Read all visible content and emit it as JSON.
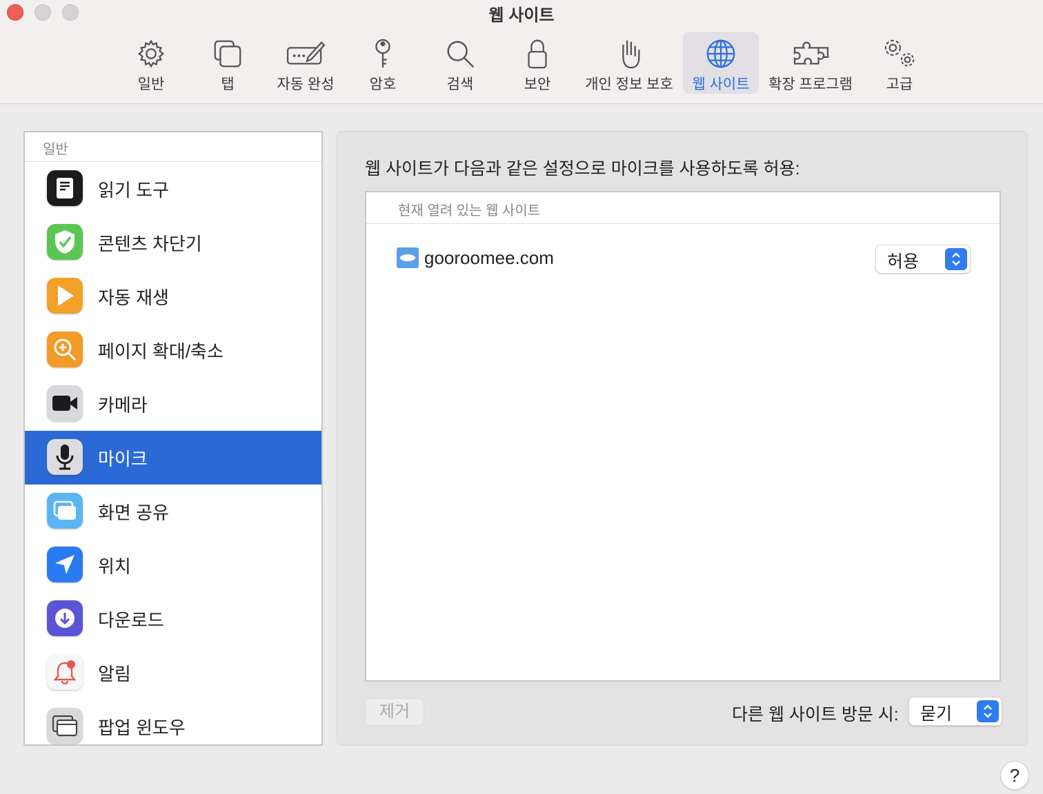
{
  "window": {
    "title": "웹 사이트"
  },
  "toolbar": [
    {
      "label": "일반",
      "icon": "gear-icon"
    },
    {
      "label": "탭",
      "icon": "tabs-icon"
    },
    {
      "label": "자동 완성",
      "icon": "autofill-pencil-icon"
    },
    {
      "label": "암호",
      "icon": "key-icon"
    },
    {
      "label": "검색",
      "icon": "magnifier-icon"
    },
    {
      "label": "보안",
      "icon": "lock-icon"
    },
    {
      "label": "개인 정보 보호",
      "icon": "hand-icon"
    },
    {
      "label": "웹 사이트",
      "icon": "globe-icon",
      "active": true
    },
    {
      "label": "확장 프로그램",
      "icon": "puzzle-icon"
    },
    {
      "label": "고급",
      "icon": "gears-icon"
    }
  ],
  "sidebar": {
    "header": "일반",
    "items": [
      {
        "label": "읽기 도구",
        "icon": "reader-icon"
      },
      {
        "label": "콘텐츠 차단기",
        "icon": "shield-check-icon"
      },
      {
        "label": "자동 재생",
        "icon": "play-icon"
      },
      {
        "label": "페이지 확대/축소",
        "icon": "zoom-icon"
      },
      {
        "label": "카메라",
        "icon": "camera-icon"
      },
      {
        "label": "마이크",
        "icon": "microphone-icon",
        "selected": true
      },
      {
        "label": "화면 공유",
        "icon": "screen-share-icon"
      },
      {
        "label": "위치",
        "icon": "location-arrow-icon"
      },
      {
        "label": "다운로드",
        "icon": "download-icon"
      },
      {
        "label": "알림",
        "icon": "bell-icon"
      },
      {
        "label": "팝업 윈도우",
        "icon": "popup-window-icon"
      }
    ]
  },
  "main": {
    "description": "웹 사이트가 다음과 같은 설정으로 마이크를 사용하도록 허용:",
    "list_header": "현재 열려 있는 웹 사이트",
    "sites": [
      {
        "domain": "gooroomee.com",
        "setting": "허용"
      }
    ],
    "remove_label": "제거",
    "other_sites_label": "다른 웹 사이트 방문 시:",
    "other_sites_value": "묻기"
  },
  "help": {
    "label": "?"
  },
  "colors": {
    "accent": "#2b69d6",
    "selected_row": "#2b69d6",
    "close_button": "#ee5f57"
  }
}
